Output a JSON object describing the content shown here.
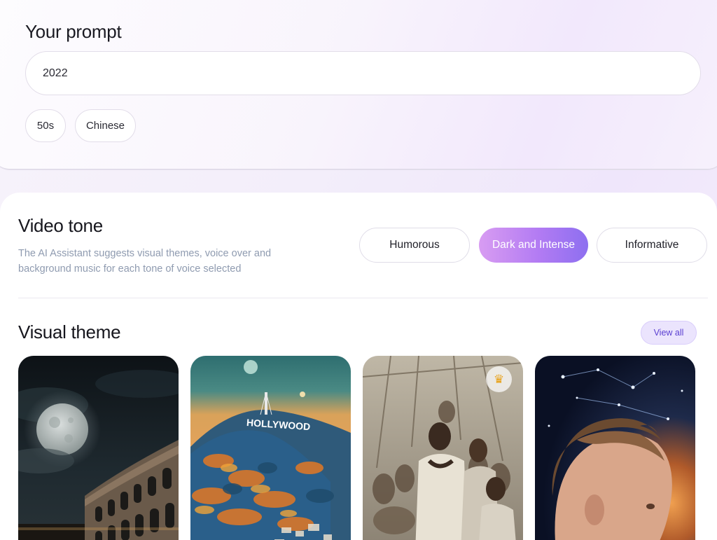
{
  "prompt": {
    "title": "Your prompt",
    "input_value": "2022",
    "chips": [
      "50s",
      "Chinese"
    ]
  },
  "tone": {
    "title": "Video tone",
    "description": "The AI Assistant suggests visual themes, voice over and background music for each tone of voice selected",
    "options": [
      "Humorous",
      "Dark and Intense",
      "Informative"
    ],
    "selected": "Dark and Intense"
  },
  "visual_theme": {
    "title": "Visual theme",
    "view_all_label": "View all",
    "cards": [
      {
        "subject": "moonlit colosseum"
      },
      {
        "subject": "hollywood sign hills",
        "sign_text": "HOLLYWOOD"
      },
      {
        "subject": "men on ship deck",
        "badge_icon": "crown-icon"
      },
      {
        "subject": "child looking at cosmos"
      }
    ]
  },
  "colors": {
    "accent_gradient_start": "#d89cf2",
    "accent_gradient_end": "#8d6ff0",
    "view_all_text": "#5a3fd1",
    "muted_text": "#8f9bb0"
  }
}
